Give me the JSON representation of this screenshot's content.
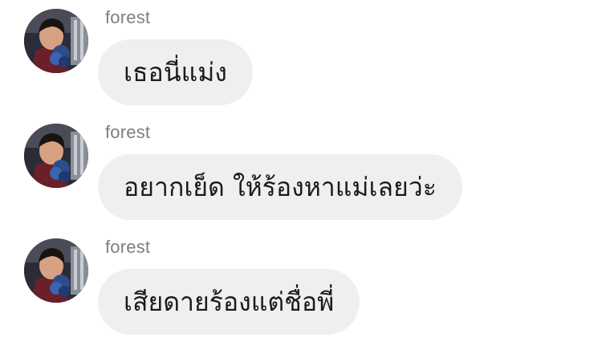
{
  "messages": [
    {
      "sender": "forest",
      "avatar_icon": "profile-photo",
      "text": "เธอนี่แม่ง"
    },
    {
      "sender": "forest",
      "avatar_icon": "profile-photo",
      "text": "อยากเย็ด ให้ร้องหาแม่เลยว่ะ"
    },
    {
      "sender": "forest",
      "avatar_icon": "profile-photo",
      "text": "เสียดายร้องแต่ชื่อพี่"
    }
  ],
  "colors": {
    "background": "#ffffff",
    "bubble": "#efefef",
    "sender_text": "#7f7f84",
    "message_text": "#1b1b1b"
  }
}
